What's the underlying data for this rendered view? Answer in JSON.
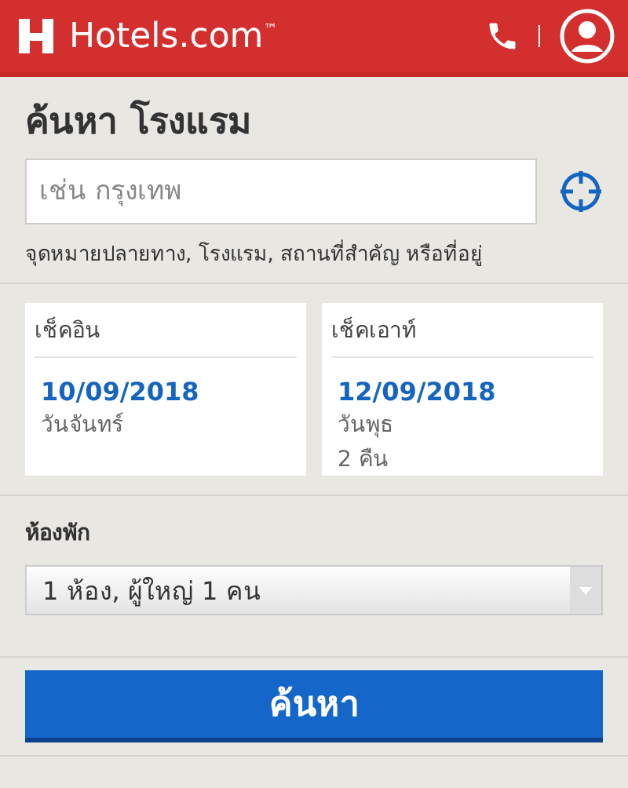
{
  "header": {
    "brand": "Hotels.com$^{™}$"
  },
  "search": {
    "title": "ค้นหา โรงแรม",
    "placeholder": "เช่น กรุงเทพ",
    "hint": "จุดหมายปลายทาง, โรงแรม, สถานที่สำคัญ หรือที่อยู่"
  },
  "dates": [
    {
      "label": "เช็คอิน",
      "date": "10/09/2018",
      "lines": [
        "วันจันทร์"
      ]
    },
    {
      "label": "เช็คเอาท์",
      "date": "12/09/2018",
      "lines": [
        "วันพุธ",
        "2 คืน"
      ]
    }
  ],
  "rooms": {
    "label": "ห้องพัก",
    "value": "1 ห้อง, ผู้ใหญ่ 1 คน"
  },
  "button": "ค้นหา"
}
